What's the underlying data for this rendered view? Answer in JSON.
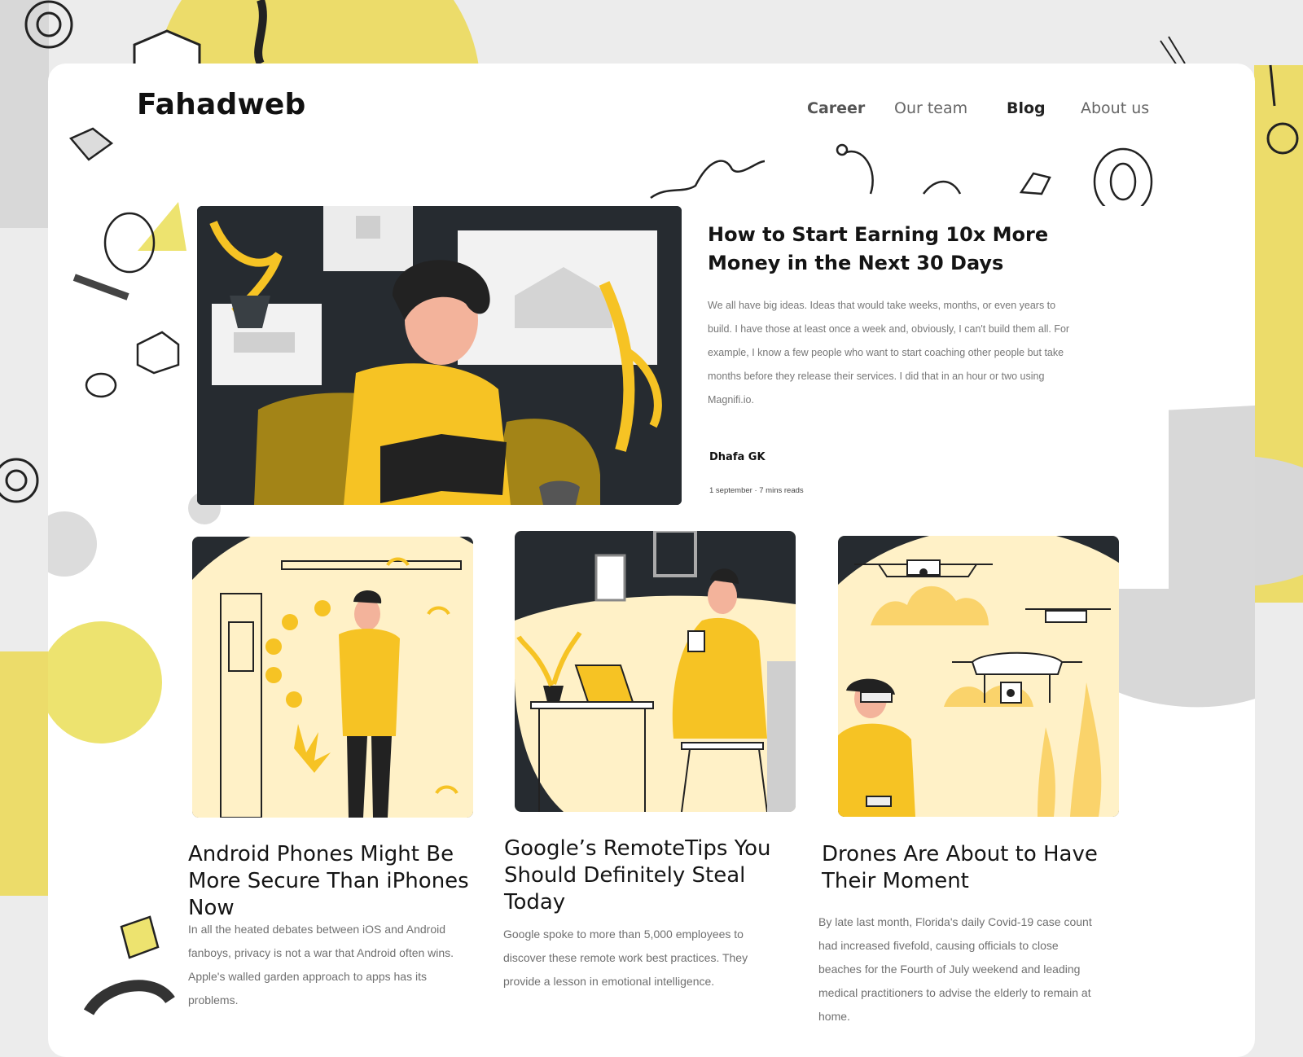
{
  "brand": "Fahadweb",
  "nav": [
    {
      "label": "Career"
    },
    {
      "label": "Our team"
    },
    {
      "label": "Blog",
      "active": true
    },
    {
      "label": "About us"
    }
  ],
  "featured": {
    "title": "How to Start Earning 10x More Money in the Next 30 Days",
    "body": "We all have big ideas. Ideas that would take weeks, months, or even years to build. I have those at least once a week and, obviously, I can't build them all.   For example, I know a few people who want to start coaching other people but take months before they release their services. I did that in an hour or two using Magnifi.io.",
    "author": "Dhafa GK",
    "meta": "1 september · 7 mins reads"
  },
  "articles": [
    {
      "title": "Android Phones Might Be More Secure Than iPhones Now",
      "body": "In all the heated debates between iOS and Android fanboys, privacy is not a war that Android often wins. Apple's walled garden approach to apps has its problems."
    },
    {
      "title": "Google’s RemoteTips You Should Definitely Steal Today",
      "body": "Google spoke to more than 5,000 employees to discover these remote work best practices. They provide a lesson in emotional intelligence."
    },
    {
      "title": "Drones Are About to Have Their Moment",
      "body": "By late last month, Florida's daily Covid-19 case count had increased fivefold, causing officials to close beaches for the Fourth of July weekend and leading medical practitioners to advise the elderly to remain at home."
    }
  ],
  "colors": {
    "accent": "#f6c324",
    "accent_light": "#fff1c7",
    "dark": "#262b30",
    "bg_yellow": "#ecdc6a",
    "bg_grey": "#d0d0d0"
  },
  "icons": [
    "cube-doodle",
    "ring-doodle",
    "squiggle-doodle",
    "house-frame",
    "plant",
    "drone",
    "wifi-icon"
  ]
}
